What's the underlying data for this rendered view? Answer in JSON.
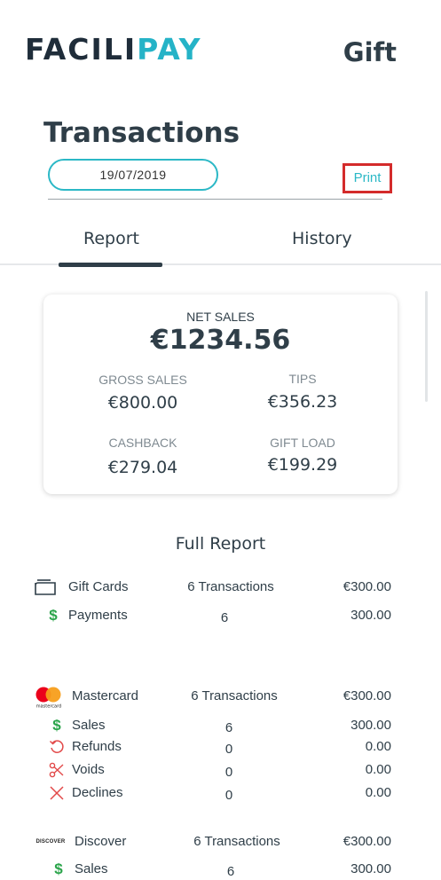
{
  "header": {
    "logo_main": "FACILI",
    "logo_accent": "PAY",
    "title": "Gift"
  },
  "page": {
    "title": "Transactions",
    "date": "19/07/2019",
    "print_label": "Print"
  },
  "tabs": [
    {
      "label": "Report",
      "active": true
    },
    {
      "label": "History",
      "active": false
    }
  ],
  "summary": {
    "net_sales_label": "NET SALES",
    "net_sales_value": "€1234.56",
    "gross_sales_label": "GROSS SALES",
    "gross_sales_value": "€800.00",
    "tips_label": "TIPS",
    "tips_value": "€356.23",
    "cashback_label": "CASHBACK",
    "cashback_value": "€279.04",
    "gift_load_label": "GIFT LOAD",
    "gift_load_value": "€199.29"
  },
  "report": {
    "title": "Full Report",
    "gift_cards": {
      "name": "Gift Cards",
      "transactions": "6 Transactions",
      "amount": "€300.00",
      "payments": {
        "label": "Payments",
        "count": "6",
        "amount": "300.00"
      }
    },
    "mastercard": {
      "name": "Mastercard",
      "logo_text": "mastercard",
      "transactions": "6 Transactions",
      "amount": "€300.00",
      "rows": [
        {
          "label": "Sales",
          "count": "6",
          "amount": "300.00"
        },
        {
          "label": "Refunds",
          "count": "0",
          "amount": "0.00"
        },
        {
          "label": "Voids",
          "count": "0",
          "amount": "0.00"
        },
        {
          "label": "Declines",
          "count": "0",
          "amount": "0.00"
        }
      ]
    },
    "discover": {
      "name": "Discover",
      "logo_text": "DISCOVER",
      "transactions": "6 Transactions",
      "amount": "€300.00",
      "sales": {
        "label": "Sales",
        "count": "6",
        "amount": "300.00"
      }
    }
  },
  "colors": {
    "accent": "#2bb8c6",
    "text": "#2f3e48",
    "green": "#2aa44a",
    "red": "#e24a4a",
    "print_border": "#d42b2b"
  }
}
